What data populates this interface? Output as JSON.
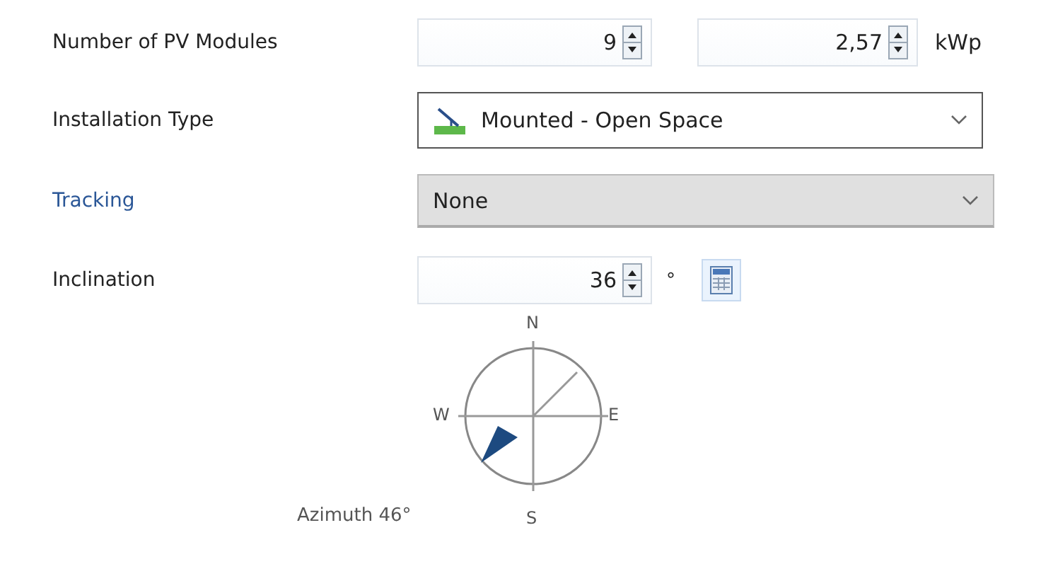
{
  "modules": {
    "label": "Number of PV Modules",
    "count": "9",
    "power": "2,57",
    "unit": "kWp"
  },
  "installation_type": {
    "label": "Installation Type",
    "value": "Mounted - Open Space"
  },
  "tracking": {
    "label": "Tracking",
    "value": "None",
    "disabled": true
  },
  "inclination": {
    "label": "Inclination",
    "value": "36",
    "unit": "°"
  },
  "compass": {
    "north": "N",
    "east": "E",
    "south": "S",
    "west": "W",
    "azimuth_label": "Azimuth 46°"
  }
}
